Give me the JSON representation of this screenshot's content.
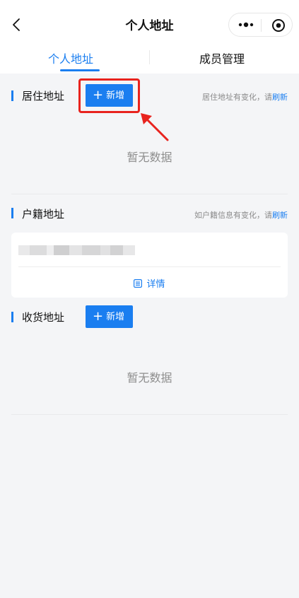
{
  "nav": {
    "title": "个人地址",
    "back_icon": "chevron-left-icon",
    "more_icon": "more-dots-icon",
    "target_icon": "target-icon"
  },
  "tabs": [
    {
      "label": "个人地址",
      "active": true
    },
    {
      "label": "成员管理",
      "active": false
    }
  ],
  "residence": {
    "title": "居住地址",
    "add_label": "新增",
    "hint_text": "居住地址有变化，请",
    "hint_link": "刷新",
    "empty_text": "暂无数据"
  },
  "household": {
    "title": "户籍地址",
    "hint_text": "如户籍信息有变化，请",
    "hint_link": "刷新",
    "detail_label": "详情"
  },
  "shipping": {
    "title": "收货地址",
    "add_label": "新增",
    "empty_text": "暂无数据"
  },
  "colors": {
    "accent": "#1a7ef0",
    "highlight": "#e8231e",
    "background": "#f4f5f7"
  }
}
